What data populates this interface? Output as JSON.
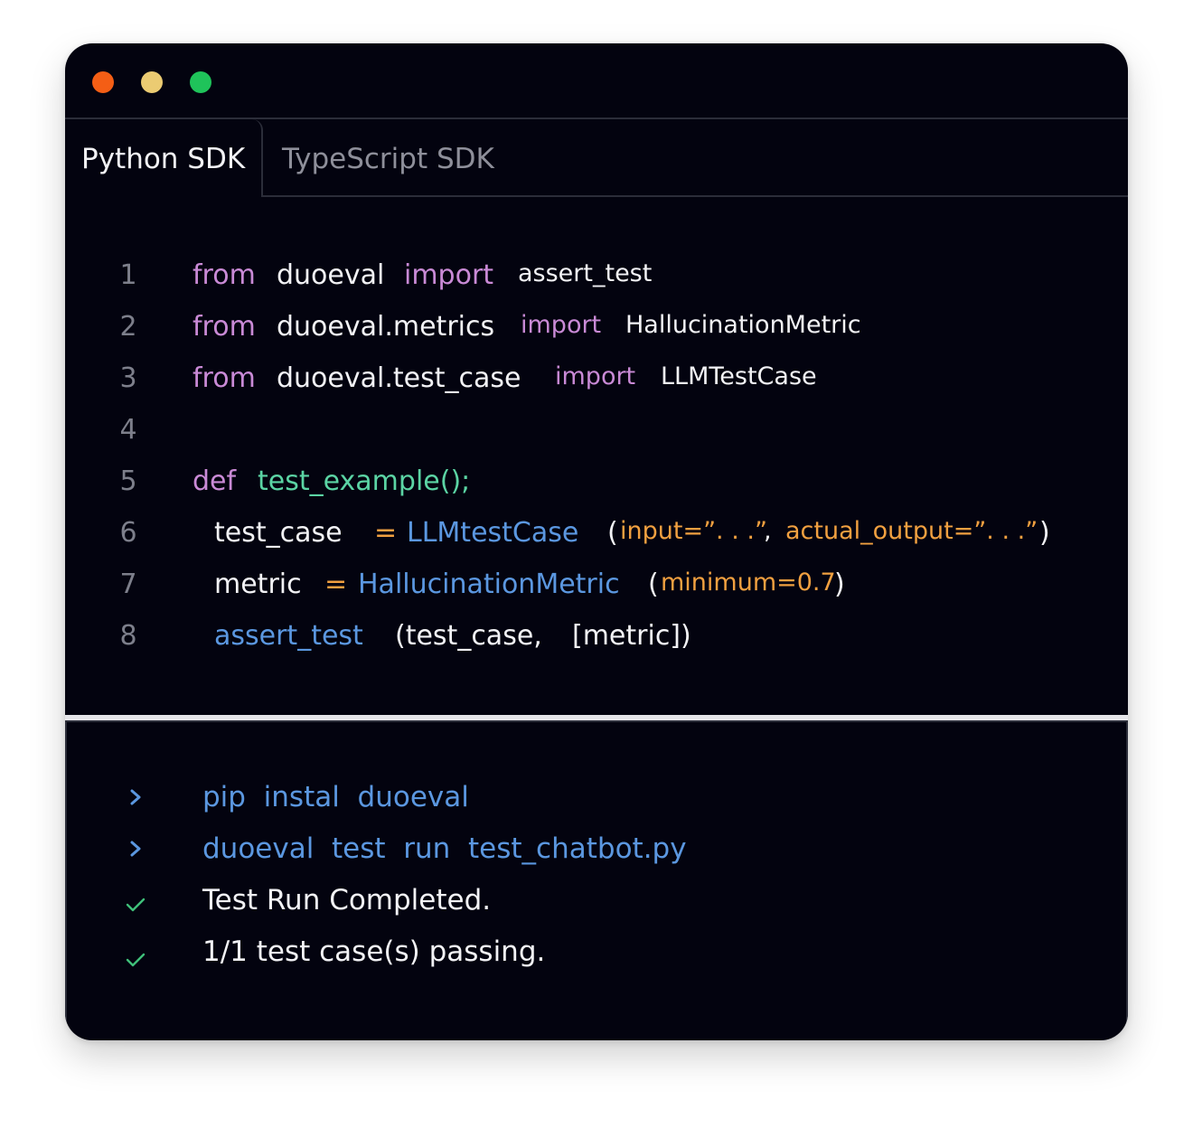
{
  "window": {
    "controls": [
      "close",
      "minimize",
      "maximize"
    ],
    "colors": {
      "close": "#f45e15",
      "minimize": "#ebcb72",
      "maximize": "#1fc35a"
    }
  },
  "tabs": [
    {
      "label": "Python SDK",
      "active": true
    },
    {
      "label": "TypeScript SDK",
      "active": false
    }
  ],
  "code": {
    "lines": [
      {
        "number": "1",
        "tokens": [
          "from",
          "duoeval",
          "import",
          "assert_test"
        ]
      },
      {
        "number": "2",
        "tokens": [
          "from",
          "duoeval.metrics",
          "import",
          "HallucinationMetric"
        ]
      },
      {
        "number": "3",
        "tokens": [
          "from",
          "duoeval.test_case",
          "import",
          "LLMTestCase"
        ]
      },
      {
        "number": "4",
        "tokens": []
      },
      {
        "number": "5",
        "tokens": [
          "def",
          "test_example();"
        ]
      },
      {
        "number": "6",
        "tokens": [
          "test_case",
          "=",
          "LLMtestCase",
          "(",
          "input=”. . .”",
          ",",
          "actual_output=”. . .”",
          ")"
        ]
      },
      {
        "number": "7",
        "tokens": [
          "metric",
          "=",
          "HallucinationMetric",
          "(",
          "minimum=0.7",
          ")"
        ]
      },
      {
        "number": "8",
        "tokens": [
          "assert_test",
          "(test_case,",
          "[metric])"
        ]
      }
    ]
  },
  "terminal": {
    "lines": [
      {
        "icon": "chevron-right-icon",
        "text": "pip  instal  duoeval"
      },
      {
        "icon": "chevron-right-icon",
        "text": "duoeval  test  run  test_chatbot.py"
      },
      {
        "icon": "check-icon",
        "text": "Test Run Completed."
      },
      {
        "icon": "check-icon",
        "text": "1/1 test case(s) passing."
      }
    ]
  },
  "colors": {
    "background": "#03030f",
    "keyword": "#c98ad6",
    "function": "#5bd4a4",
    "class": "#5b97e0",
    "parameter": "#f1a040",
    "text": "#f2f2f5",
    "success": "#3fc07a"
  }
}
